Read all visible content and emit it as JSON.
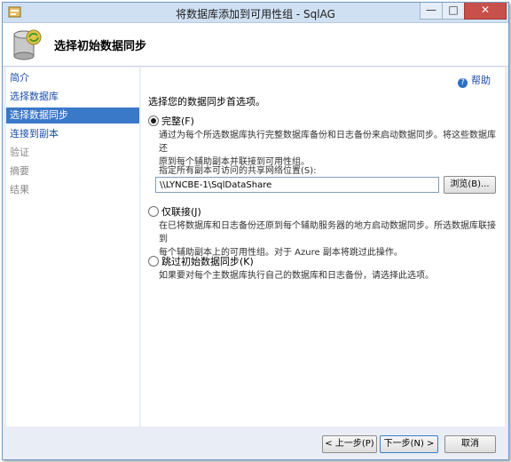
{
  "window": {
    "title": "将数据库添加到可用性组 - SqlAG",
    "minimize_glyph": "—",
    "maximize_glyph": "□",
    "close_glyph": "✕"
  },
  "header": {
    "title": "选择初始数据同步",
    "icon": "database-sync-icon"
  },
  "help": {
    "label": "帮助",
    "glyph": "?"
  },
  "nav": {
    "items": [
      {
        "label": "简介",
        "state": "link"
      },
      {
        "label": "选择数据库",
        "state": "link"
      },
      {
        "label": "选择数据同步",
        "state": "selected"
      },
      {
        "label": "连接到副本",
        "state": "link"
      },
      {
        "label": "验证",
        "state": "disabled"
      },
      {
        "label": "摘要",
        "state": "disabled"
      },
      {
        "label": "结果",
        "state": "disabled"
      }
    ]
  },
  "content": {
    "heading": "选择您的数据同步首选项。",
    "options": [
      {
        "label": "完整(F)",
        "selected": true,
        "description_line1": "通过为每个所选数据库执行完整数据库备份和日志备份来启动数据同步。将这些数据库还",
        "description_line2": "原到每个辅助副本并联接到可用性组。"
      },
      {
        "label": "仅联接(J)",
        "selected": false,
        "description_line1": "在已将数据库和日志备份还原到每个辅助服务器的地方启动数据同步。所选数据库联接到",
        "description_line2": "每个辅助副本上的可用性组。对于 Azure 副本将跳过此操作。"
      },
      {
        "label": "跳过初始数据同步(K)",
        "selected": false,
        "description_line1": "如果要对每个主数据库执行自己的数据库和日志备份，请选择此选项。"
      }
    ],
    "share_label": "指定所有副本可访问的共享网络位置(S):",
    "share_value": "\\\\LYNCBE-1\\SqlDataShare",
    "browse_label": "浏览(B)..."
  },
  "footer": {
    "prev_label": "< 上一步(P)",
    "next_label": "下一步(N) >",
    "cancel_label": "取消"
  },
  "colors": {
    "titlebar": "#cfe0f3",
    "selection": "#3a78c8",
    "link": "#1c4ea6",
    "close_button": "#c7504a"
  }
}
